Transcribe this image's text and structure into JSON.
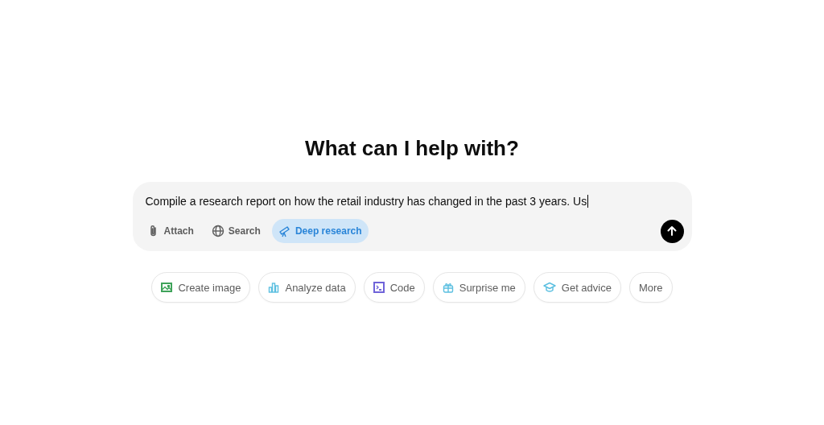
{
  "heading": "What can I help with?",
  "composer": {
    "value": "Compile a research report on how the retail industry has changed in the past 3 years. Us",
    "tools": [
      {
        "kind": "attach",
        "label": "Attach",
        "selected": false
      },
      {
        "kind": "search",
        "label": "Search",
        "selected": false
      },
      {
        "kind": "research",
        "label": "Deep research",
        "selected": true
      }
    ]
  },
  "chips": [
    {
      "kind": "image",
      "label": "Create image",
      "color": "#3fa35a"
    },
    {
      "kind": "chart",
      "label": "Analyze data",
      "color": "#5bbfe0"
    },
    {
      "kind": "code",
      "label": "Code",
      "color": "#6f63d9"
    },
    {
      "kind": "gift",
      "label": "Surprise me",
      "color": "#5bbfe0"
    },
    {
      "kind": "cap",
      "label": "Get advice",
      "color": "#5bbfe0"
    },
    {
      "kind": "text",
      "label": "More"
    }
  ]
}
